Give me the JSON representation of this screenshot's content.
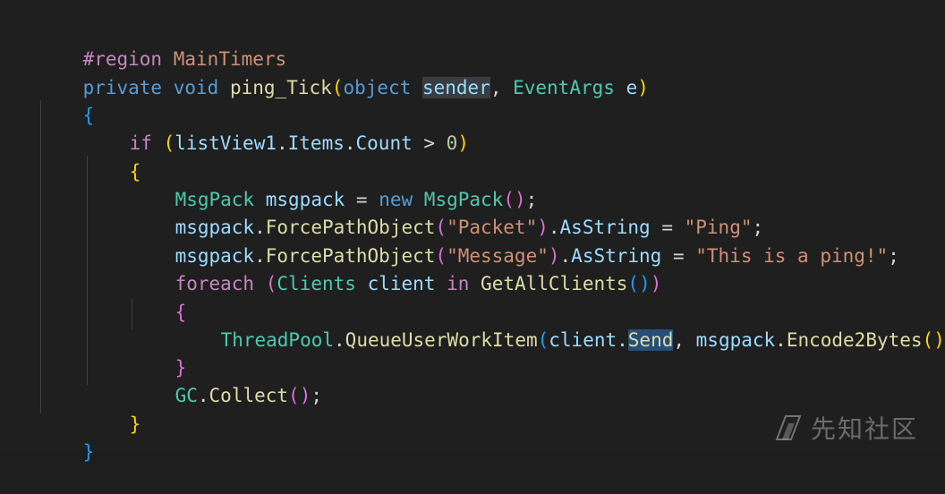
{
  "code": {
    "region": {
      "directive": "#region",
      "name": "MainTimers"
    },
    "lines": [
      [
        "private",
        " ",
        "void",
        " ",
        "ping_Tick",
        "(",
        "object",
        " ",
        "sender",
        ", ",
        "EventArgs",
        " ",
        "e",
        ")"
      ],
      [
        "{"
      ],
      [
        "if",
        " ",
        "(",
        "listView1",
        ".",
        "Items",
        ".",
        "Count",
        " > ",
        "0",
        ")"
      ],
      [
        "{"
      ],
      [
        "MsgPack",
        " ",
        "msgpack",
        " = ",
        "new",
        " ",
        "MsgPack",
        "(",
        ")",
        ";"
      ],
      [
        "msgpack",
        ".",
        "ForcePathObject",
        "(",
        "\"Packet\"",
        ")",
        ".",
        "AsString",
        " = ",
        "\"Ping\"",
        ";"
      ],
      [
        "msgpack",
        ".",
        "ForcePathObject",
        "(",
        "\"Message\"",
        ")",
        ".",
        "AsString",
        " = ",
        "\"This is a ping!\"",
        ";"
      ],
      [
        "foreach",
        " ",
        "(",
        "Clients",
        " ",
        "client",
        " ",
        "in",
        " ",
        "GetAllClients",
        "(",
        ")",
        ")"
      ],
      [
        "{"
      ],
      [
        "ThreadPool",
        ".",
        "QueueUserWorkItem",
        "(",
        "client",
        ".",
        "Send",
        ", ",
        "msgpack",
        ".",
        "Encode2Bytes",
        "(",
        ")",
        ")",
        ";"
      ],
      [
        "}"
      ],
      [
        "GC",
        ".",
        "Collect",
        "(",
        ")",
        ";"
      ],
      [
        "}"
      ],
      [
        "}"
      ]
    ]
  },
  "watermark": {
    "text": "先知社区",
    "logo_icon": "xianzhi-logo-icon"
  }
}
